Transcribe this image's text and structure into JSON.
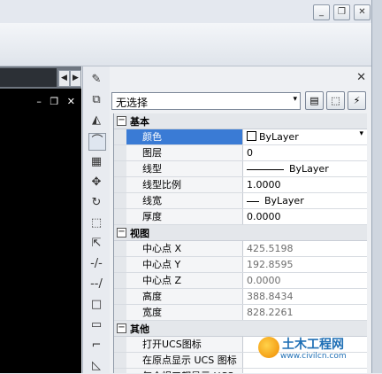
{
  "window": {
    "controls": {
      "minimize": "_",
      "restore": "❐",
      "close": "✕"
    }
  },
  "canvas": {
    "viewport_controls": "– ❐ ✕",
    "tab_arrows": {
      "left": "◀",
      "right": "▶"
    }
  },
  "toolstrip": {
    "tools": [
      "eraser-icon",
      "copy-object-icon",
      "mirror-icon",
      "offset-icon",
      "array-icon",
      "move-icon",
      "rotate-icon",
      "scale-icon",
      "stretch-icon",
      "trim-icon",
      "extend-icon",
      "break-icon",
      "join-icon",
      "chamfer-icon",
      "fillet-icon"
    ]
  },
  "palette": {
    "close": "✕",
    "selection": {
      "value": "无选择",
      "arrow": "▾"
    },
    "buttons": {
      "toggle_pickadd": "▤",
      "select_objects": "⬚",
      "quick_select": "⚡"
    },
    "sections": [
      {
        "title": "基本",
        "toggle": "−",
        "rows": [
          {
            "key": "颜色",
            "value": "ByLayer",
            "kind": "color",
            "active": true
          },
          {
            "key": "图层",
            "value": "0",
            "kind": "text"
          },
          {
            "key": "线型",
            "value": "ByLayer",
            "kind": "linetype"
          },
          {
            "key": "线型比例",
            "value": "1.0000",
            "kind": "text"
          },
          {
            "key": "线宽",
            "value": "ByLayer",
            "kind": "lineweight"
          },
          {
            "key": "厚度",
            "value": "0.0000",
            "kind": "text"
          }
        ]
      },
      {
        "title": "视图",
        "toggle": "−",
        "rows": [
          {
            "key": "中心点 X",
            "value": "425.5198",
            "kind": "readonly"
          },
          {
            "key": "中心点 Y",
            "value": "192.8595",
            "kind": "readonly"
          },
          {
            "key": "中心点 Z",
            "value": "0.0000",
            "kind": "readonly"
          },
          {
            "key": "高度",
            "value": "388.8434",
            "kind": "readonly"
          },
          {
            "key": "宽度",
            "value": "828.2261",
            "kind": "readonly"
          }
        ]
      },
      {
        "title": "其他",
        "toggle": "−",
        "rows": [
          {
            "key": "打开UCS图标",
            "value": "",
            "kind": "text"
          },
          {
            "key": "在原点显示 UCS 图标",
            "value": "",
            "kind": "text"
          },
          {
            "key": "每个视口都显示 UCS",
            "value": "",
            "kind": "text"
          }
        ]
      }
    ]
  },
  "watermark": {
    "brand": "土木工程网",
    "url": "www.civilcn.com"
  },
  "colors": {
    "active_row": "#3a7bd5",
    "canvas": "#000000",
    "watermark": "#1f6fb5"
  }
}
